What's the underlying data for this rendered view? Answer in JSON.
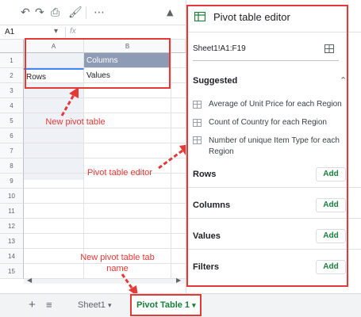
{
  "formula_bar": {
    "cell_ref": "A1",
    "fx": "fx"
  },
  "grid": {
    "columns": [
      "A",
      "B"
    ],
    "rows": [
      "1",
      "2",
      "3",
      "4",
      "5",
      "6",
      "7",
      "8",
      "9",
      "10",
      "11",
      "12",
      "13",
      "14",
      "15"
    ],
    "cells": {
      "B1": "Columns",
      "A2": "Rows",
      "B2": "Values"
    }
  },
  "sheet_tabs": {
    "sheet1": "Sheet1",
    "pivot": "Pivot Table 1"
  },
  "editor": {
    "title": "Pivot table editor",
    "range": "Sheet1!A1:F19",
    "suggested_label": "Suggested",
    "suggestions": [
      "Average of Unit Price for each Region",
      "Count of Country for each Region",
      "Number of unique Item Type for each Region"
    ],
    "sections": [
      "Rows",
      "Columns",
      "Values",
      "Filters"
    ],
    "add_label": "Add"
  },
  "annotations": {
    "new_pivot_table": "New pivot table",
    "pivot_table_editor": "Pivot table editor",
    "new_tab_name_line1": "New pivot table tab",
    "new_tab_name_line2": "name"
  },
  "colors": {
    "pivot_header_bg": "#8e9bb5",
    "annotation_red": "#e53935",
    "accent_green": "#188038"
  }
}
